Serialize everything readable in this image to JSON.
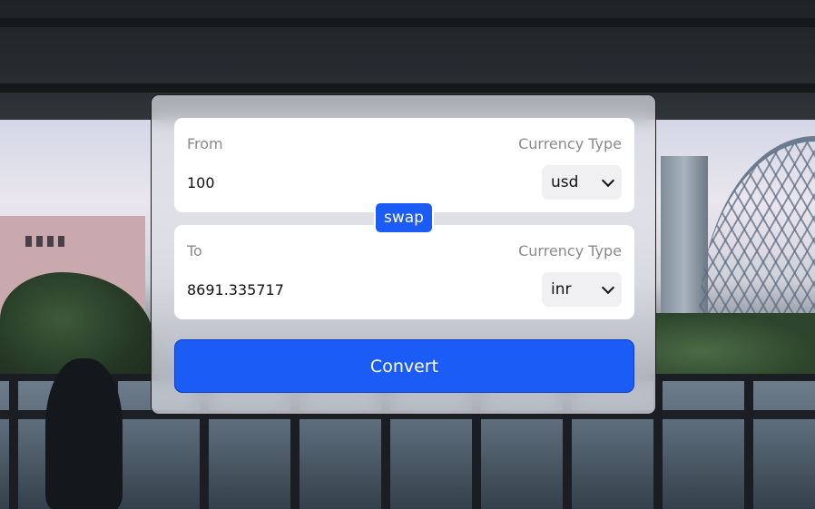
{
  "converter": {
    "from": {
      "label": "From",
      "currency_type_label": "Currency Type",
      "amount": "100",
      "currency": "usd"
    },
    "to": {
      "label": "To",
      "currency_type_label": "Currency Type",
      "amount": "8691.335717",
      "currency": "inr"
    },
    "swap_label": "swap",
    "convert_label": "Convert"
  },
  "colors": {
    "primary": "#1a5cf5",
    "panel": "#ffffff",
    "muted_text": "#8a8a8a"
  }
}
